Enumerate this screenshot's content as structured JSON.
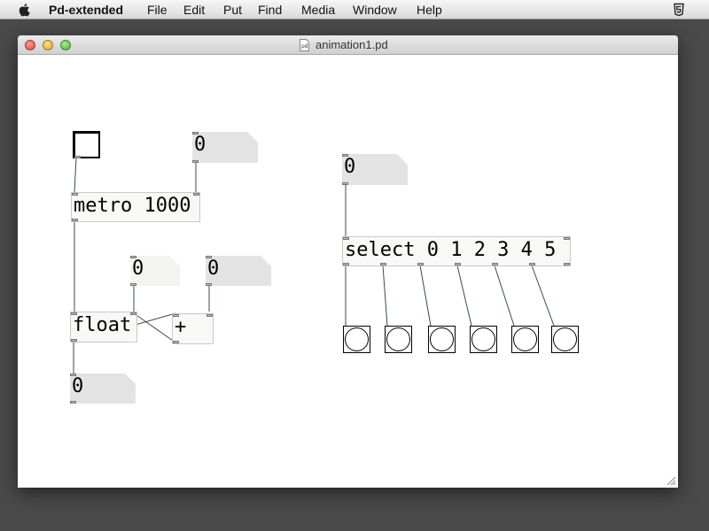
{
  "menubar": {
    "app_name": "Pd-extended",
    "items": [
      "File",
      "Edit",
      "Put",
      "Find",
      "Media",
      "Window",
      "Help"
    ],
    "apple_icon": "apple-icon",
    "system_icon": "accessibility-icon"
  },
  "window": {
    "title": "animation1.pd",
    "doc_icon": "pd-document-icon",
    "controls": [
      "close",
      "minimize",
      "zoom"
    ],
    "colors": {
      "close": "#e0443a",
      "minimize": "#e0a21c",
      "zoom": "#4fae32"
    }
  },
  "patch": {
    "toggle_label": "toggle",
    "metro": {
      "text": "metro 1000"
    },
    "float": {
      "text": "float"
    },
    "plus": {
      "text": "+"
    },
    "select": {
      "text": "select 0 1 2 3 4 5"
    },
    "numbers": {
      "metro_interval": "0",
      "float_right": "0",
      "plus_right": "0",
      "counter_out": "0",
      "select_in": "0"
    },
    "bangs": [
      "bang-0",
      "bang-1",
      "bang-2",
      "bang-3",
      "bang-4",
      "bang-5"
    ]
  }
}
